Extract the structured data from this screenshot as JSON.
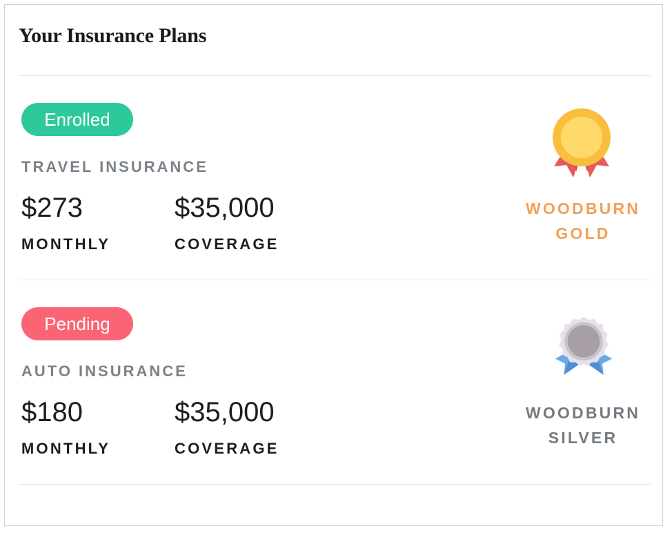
{
  "header": {
    "title": "Your Insurance Plans"
  },
  "plans": [
    {
      "status": "Enrolled",
      "status_color": "#2ec99b",
      "type": "TRAVEL INSURANCE",
      "monthly_amount": "$273",
      "monthly_label": "MONTHLY",
      "coverage_amount": "$35,000",
      "coverage_label": "COVERAGE",
      "tier_line1": "WOODBURN",
      "tier_line2": "GOLD",
      "tier_color": "#f4a057",
      "medal_icon": "gold-medal-icon"
    },
    {
      "status": "Pending",
      "status_color": "#fb6475",
      "type": "AUTO INSURANCE",
      "monthly_amount": "$180",
      "monthly_label": "MONTHLY",
      "coverage_amount": "$35,000",
      "coverage_label": "COVERAGE",
      "tier_line1": "WOODBURN",
      "tier_line2": "SILVER",
      "tier_color": "#737a80",
      "medal_icon": "silver-medal-icon"
    }
  ]
}
